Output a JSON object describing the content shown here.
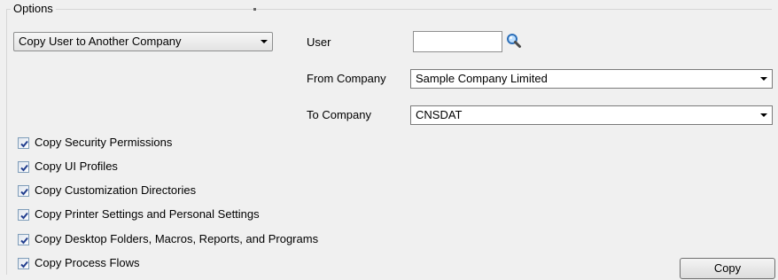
{
  "options": {
    "legend": "Options",
    "mode_select": {
      "value": "Copy User to Another Company"
    },
    "user": {
      "label": "User",
      "value": "",
      "icon": "magnifier-icon"
    },
    "from_company": {
      "label": "From Company",
      "value": "Sample Company Limited"
    },
    "to_company": {
      "label": "To Company",
      "value": "CNSDAT"
    },
    "checkboxes": [
      {
        "label": "Copy Security Permissions",
        "checked": true
      },
      {
        "label": "Copy UI Profiles",
        "checked": true
      },
      {
        "label": "Copy Customization Directories",
        "checked": true
      },
      {
        "label": "Copy Printer Settings and Personal Settings",
        "checked": true
      },
      {
        "label": "Copy Desktop Folders, Macros, Reports, and Programs",
        "checked": true
      },
      {
        "label": "Copy Process Flows",
        "checked": true
      }
    ],
    "copy_button": {
      "label": "Copy"
    }
  },
  "colors": {
    "window_bg": "#f0f0f0",
    "border": "#d6d6d6",
    "field_border": "#7a7a7a",
    "check_blue": "#233f8f"
  }
}
